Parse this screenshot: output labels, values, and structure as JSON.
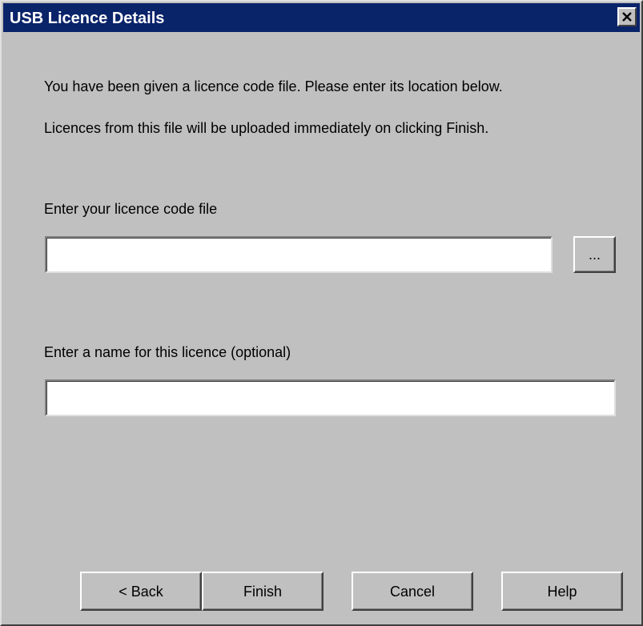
{
  "window": {
    "title": "USB Licence Details",
    "close_icon": "close-icon"
  },
  "intro": {
    "line1": "You have been given a licence code file. Please enter its location below.",
    "line2": "Licences from this file will be uploaded immediately on clicking Finish."
  },
  "licence_file": {
    "label": "Enter your licence code file",
    "value": "",
    "browse_label": "..."
  },
  "licence_name": {
    "label": "Enter a name for this licence (optional)",
    "value": ""
  },
  "buttons": {
    "back": "< Back",
    "finish": "Finish",
    "cancel": "Cancel",
    "help": "Help"
  },
  "colors": {
    "titlebar": "#0a246a",
    "dialog_face": "#c0c0c0"
  }
}
